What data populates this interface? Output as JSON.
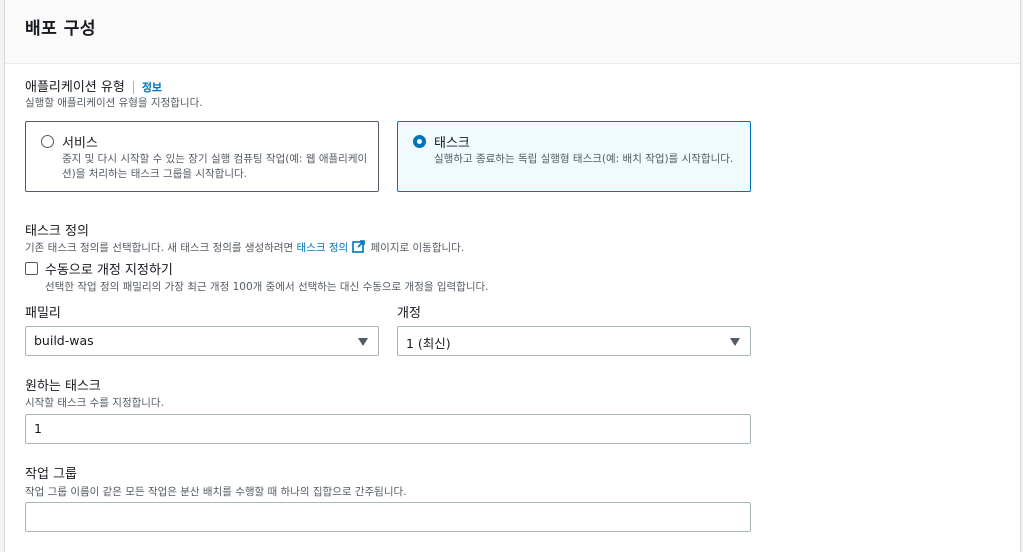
{
  "panel": {
    "title": "배포 구성"
  },
  "app_type": {
    "label": "애플리케이션 유형",
    "info_link": "정보",
    "description": "실행할 애플리케이션 유형을 지정합니다.",
    "options": [
      {
        "title": "서비스",
        "description": "중지 및 다시 시작할 수 있는 장기 실행 컴퓨팅 작업(예: 웹 애플리케이션)을 처리하는 태스크 그룹을 시작합니다.",
        "selected": false
      },
      {
        "title": "태스크",
        "description": "실행하고 종료하는 독립 실행형 태스크(예: 배치 작업)를 시작합니다.",
        "selected": true
      }
    ]
  },
  "task_definition": {
    "label": "태스크 정의",
    "description_before": "기존 태스크 정의를 선택합니다. 새 태스크 정의를 생성하려면 ",
    "description_link": "태스크 정의",
    "description_after": " 페이지로 이동합니다.",
    "manual_checkbox": {
      "label": "수동으로 개정 지정하기",
      "description": "선택한 작업 정의 패밀리의 가장 최근 개정 100개 중에서 선택하는 대신 수동으로 개정을 입력합니다.",
      "checked": false
    },
    "family": {
      "label": "패밀리",
      "value": "build-was"
    },
    "revision": {
      "label": "개정",
      "value": "1 (최신)"
    }
  },
  "desired_tasks": {
    "label": "원하는 태스크",
    "description": "시작할 태스크 수를 지정합니다.",
    "value": "1"
  },
  "task_group": {
    "label": "작업 그룹",
    "description": "작업 그룹 이름이 같은 모든 작업은 분산 배치를 수행할 때 하나의 집합으로 간주됩니다.",
    "value": ""
  },
  "colors": {
    "accent": "#0073bb",
    "selected_bg": "#f1faff",
    "text": "#16191f",
    "muted": "#545b64"
  }
}
